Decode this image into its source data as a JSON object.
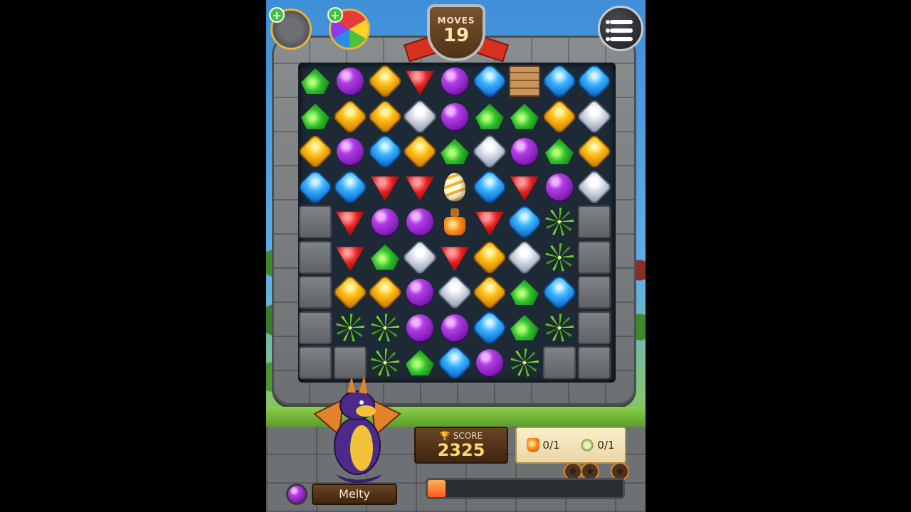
{
  "hud": {
    "moves_label": "MOVES",
    "moves_value": "19",
    "plus_symbol": "+",
    "boosters": [
      "hammer-icon",
      "wand-icon"
    ]
  },
  "board": {
    "rows": [
      [
        "green",
        "purple",
        "yellow",
        "red",
        "purple",
        "blue",
        "crate",
        "blue",
        "blue"
      ],
      [
        "green",
        "yellow",
        "yellow",
        "white",
        "purple",
        "green",
        "green",
        "yellow",
        "white"
      ],
      [
        "yellow",
        "purple",
        "blue",
        "yellow",
        "green",
        "white",
        "purple",
        "green",
        "yellow"
      ],
      [
        "blue",
        "blue",
        "red",
        "red",
        "egg",
        "blue",
        "red",
        "purple",
        "white"
      ],
      [
        "stone",
        "red",
        "purple",
        "purple",
        "potion",
        "red",
        "blue",
        "vine",
        "stone"
      ],
      [
        "stone",
        "red",
        "green",
        "white",
        "red",
        "yellow",
        "white",
        "vine",
        "stone"
      ],
      [
        "stone",
        "yellow",
        "yellow",
        "purple",
        "white",
        "yellow",
        "green",
        "blue",
        "stone"
      ],
      [
        "stone",
        "vine",
        "vine",
        "purple",
        "purple",
        "blue",
        "green",
        "vine",
        "stone"
      ],
      [
        "stone",
        "stone",
        "vine",
        "green",
        "blue",
        "purple",
        "vine",
        "stone",
        "stone"
      ]
    ]
  },
  "character": {
    "name": "Melty",
    "gem_color": "purple"
  },
  "score": {
    "label": "SCORE",
    "value": "2325"
  },
  "goals": [
    {
      "icon": "potion-icon",
      "text": "0/1"
    },
    {
      "icon": "vine-icon",
      "text": "0/1"
    }
  ],
  "progress": {
    "fraction": 0.09
  },
  "stars": [
    "★",
    "★",
    "★"
  ],
  "colors": {
    "accent": "#e7b43c",
    "board_bg": "#1d2a35"
  }
}
